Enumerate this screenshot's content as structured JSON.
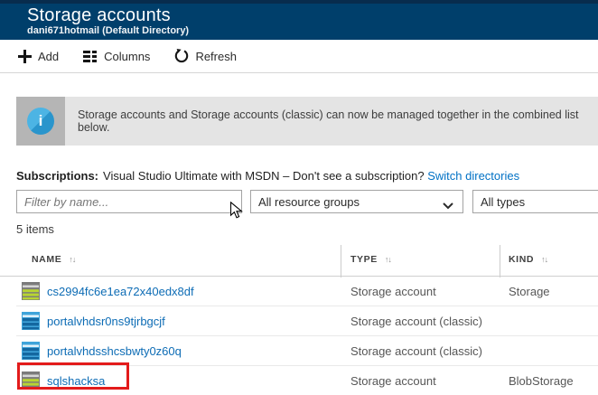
{
  "header": {
    "title": "Storage accounts",
    "subtitle": "dani671hotmail (Default Directory)"
  },
  "toolbar": {
    "add_label": "Add",
    "columns_label": "Columns",
    "refresh_label": "Refresh"
  },
  "banner": {
    "icon": "info-icon",
    "icon_glyph": "i",
    "text": "Storage accounts and Storage accounts (classic) can now be managed together in the combined list below."
  },
  "subscriptions": {
    "label": "Subscriptions:",
    "value": "Visual Studio Ultimate with MSDN – Don't see a subscription?",
    "link": "Switch directories"
  },
  "filters": {
    "name_placeholder": "Filter by name...",
    "resource_groups_value": "All resource groups",
    "types_value": "All types"
  },
  "items_count": "5 items",
  "table": {
    "columns": [
      {
        "label": "NAME",
        "sort_glyph": "↑↓"
      },
      {
        "label": "TYPE",
        "sort_glyph": "↑↓"
      },
      {
        "label": "KIND",
        "sort_glyph": "↑↓"
      }
    ],
    "rows": [
      {
        "name": "cs2994fc6e1ea72x40edx8df",
        "type": "Storage account",
        "kind": "Storage",
        "icon": "storage-account-icon"
      },
      {
        "name": "portalvhdsr0ns9tjrbgcjf",
        "type": "Storage account (classic)",
        "kind": "",
        "icon": "classic-storage-account-icon"
      },
      {
        "name": "portalvhdsshcsbwty0z60q",
        "type": "Storage account (classic)",
        "kind": "",
        "icon": "classic-storage-account-icon"
      },
      {
        "name": "sqlshacksa",
        "type": "Storage account",
        "kind": "BlobStorage",
        "icon": "storage-account-icon",
        "highlighted": true
      }
    ]
  },
  "colors": {
    "header_bg": "#003f6b",
    "link_blue": "#0071c5",
    "row_link_blue": "#0d6cb5",
    "banner_bg": "#e4e4e4",
    "banner_square": "#b5b5b5",
    "info_blue_light": "#4cb4e4",
    "info_blue_dark": "#2a95cc",
    "highlight_red": "#e31b1b",
    "storage_icon_lime": "#b8d432",
    "storage_icon_gray": "#7b7b7b",
    "classic_icon_dark_blue": "#1467a0",
    "classic_icon_light_blue": "#3fa4da"
  }
}
